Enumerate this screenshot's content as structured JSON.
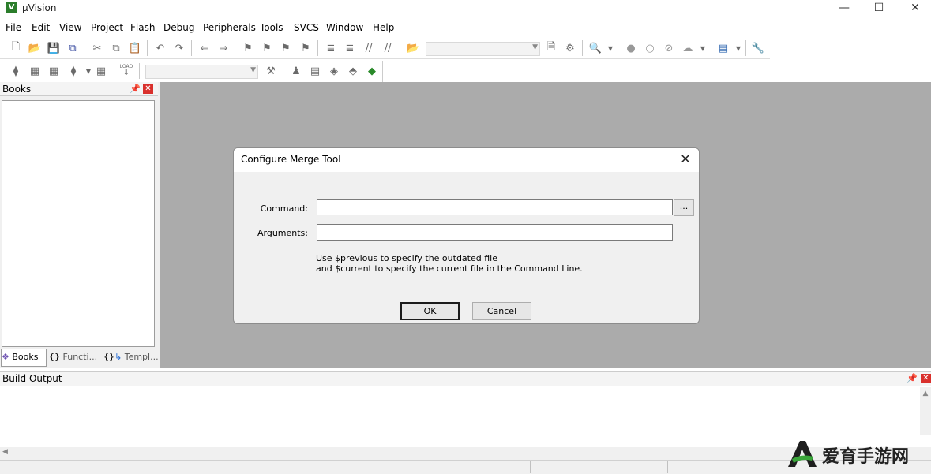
{
  "app": {
    "title": "µVision",
    "icon_letter": "V"
  },
  "window_controls": {
    "minimize": "—",
    "maximize": "☐",
    "close": "✕"
  },
  "menu": [
    "File",
    "Edit",
    "View",
    "Project",
    "Flash",
    "Debug",
    "Peripherals",
    "Tools",
    "SVCS",
    "Window",
    "Help"
  ],
  "toolbar1": {
    "icons": [
      "new-file-icon",
      "open-folder-icon",
      "save-icon",
      "save-all-icon",
      "cut-icon",
      "copy-icon",
      "paste-icon",
      "undo-icon",
      "redo-icon",
      "navigate-back-icon",
      "navigate-forward-icon",
      "bookmark-icon",
      "bookmark-prev-icon",
      "bookmark-next-icon",
      "bookmark-clear-icon",
      "indent-icon",
      "unindent-icon",
      "comment-icon",
      "uncomment-icon",
      "find-in-files-icon",
      "find-icon",
      "incremental-find-icon",
      "zoom-icon",
      "breakpoint-icon",
      "breakpoint-disabled-icon",
      "breakpoint-kill-icon",
      "debug-session-icon",
      "window-layout-icon",
      "configure-icon"
    ],
    "combo_value": ""
  },
  "toolbar2": {
    "icons": [
      "translate-icon",
      "build-icon",
      "rebuild-icon",
      "batch-build-icon",
      "stop-build-icon",
      "load-icon",
      "target-options-icon",
      "manage-components-icon",
      "manage-project-icon",
      "select-packs-icon",
      "pack-installer-icon",
      "run-time-env-icon"
    ],
    "load_label": "LOAD",
    "target_value": ""
  },
  "books_panel": {
    "title": "Books",
    "tabs": [
      {
        "label": "Books",
        "icon": "books-icon"
      },
      {
        "label": "Functi...",
        "icon": "functions-braces-icon"
      },
      {
        "label": "Templ...",
        "icon": "templates-icon"
      }
    ]
  },
  "dialog": {
    "title": "Configure Merge Tool",
    "command_label": "Command:",
    "command_value": "",
    "browse_label": "...",
    "arguments_label": "Arguments:",
    "arguments_value": "",
    "hint_line1": "Use $previous to specify the outdated file",
    "hint_line2": "and $current to specify the current file in the Command Line.",
    "ok_label": "OK",
    "cancel_label": "Cancel"
  },
  "build_output": {
    "title": "Build Output",
    "content": ""
  },
  "watermark": {
    "text": "爱育手游网",
    "brand_color": "#3aa63a"
  },
  "colors": {
    "main_background": "#ababab",
    "dialog_background": "#f0f0f0",
    "close_red": "#d9302c"
  }
}
